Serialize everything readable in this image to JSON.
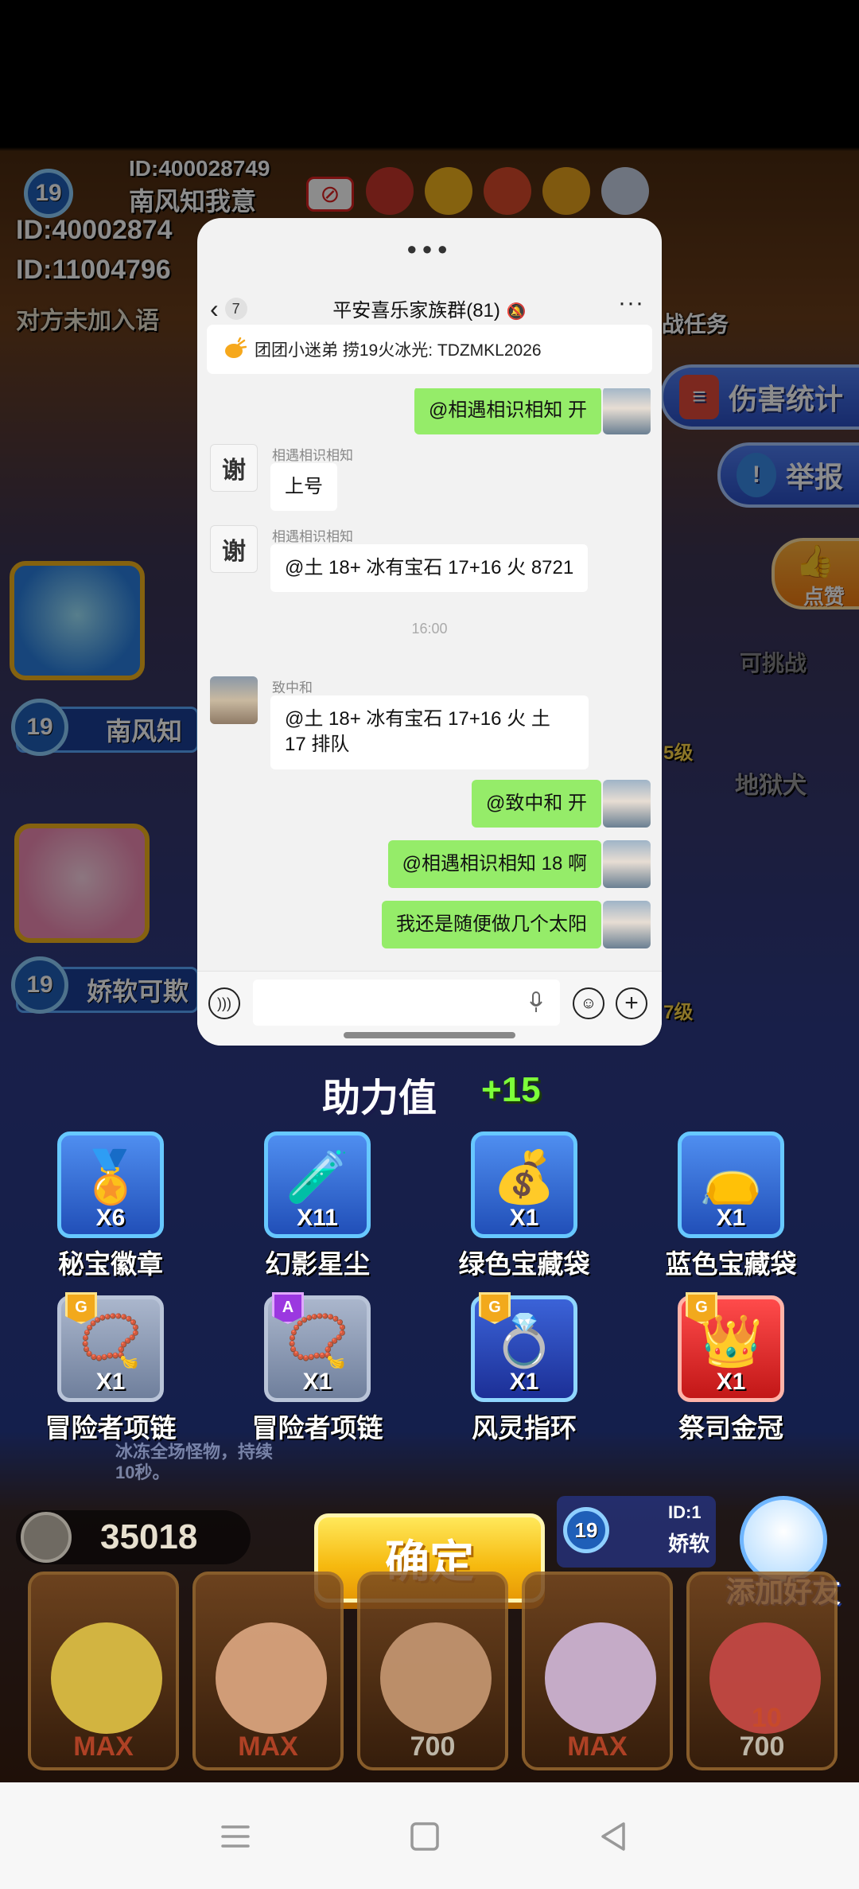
{
  "game": {
    "top_player": {
      "id": "ID:400028749",
      "level": "19",
      "name": "南风知我意"
    },
    "id_lines": [
      "ID:40002874",
      "ID:11004796"
    ],
    "voice_notice": "对方未加入语",
    "tasks_label": "战任务",
    "side_buttons": {
      "damage": "伤害统计",
      "report": "举报",
      "like": "点赞"
    },
    "slots": [
      {
        "level": "19",
        "name": "南风知"
      },
      {
        "level": "19",
        "name": "娇软可欺"
      }
    ],
    "right_labels": {
      "challenge": "可挑战",
      "hellhound": "地狱犬",
      "level_a": "5级",
      "level_b": "7级"
    },
    "assist": {
      "title": "助力值",
      "value": "+15"
    },
    "rewards": [
      {
        "name": "秘宝徽章",
        "qty": "X6",
        "icon": "exp-badge-icon",
        "style": "normal"
      },
      {
        "name": "幻影星尘",
        "qty": "X11",
        "icon": "stardust-bottle-icon",
        "style": "normal"
      },
      {
        "name": "绿色宝藏袋",
        "qty": "X1",
        "icon": "green-bag-icon",
        "style": "normal"
      },
      {
        "name": "蓝色宝藏袋",
        "qty": "X1",
        "icon": "blue-bag-icon",
        "style": "normal"
      },
      {
        "name": "冒险者项链",
        "qty": "X1",
        "icon": "necklace-icon",
        "style": "gray",
        "grade": "G"
      },
      {
        "name": "冒险者项链",
        "qty": "X1",
        "icon": "necklace-icon",
        "style": "gray",
        "grade": "A"
      },
      {
        "name": "风灵指环",
        "qty": "X1",
        "icon": "ring-icon",
        "style": "blue",
        "grade": "G"
      },
      {
        "name": "祭司金冠",
        "qty": "X1",
        "icon": "crown-icon",
        "style": "red",
        "grade": "G"
      }
    ],
    "bottom_tip": "冰冻全场怪物，持续10秒。",
    "coins": "35018",
    "confirm_label": "确定",
    "add_friend_label": "添加好友",
    "opponent_level": "19",
    "opponent_name": "娇软",
    "opponent_id": "ID:1",
    "hero_tags": [
      "MAX",
      "MAX",
      "700",
      "MAX",
      "700"
    ],
    "hero_counter": "10"
  },
  "chat": {
    "title": "平安喜乐家族群(81)",
    "unread_count": "7",
    "pinned": "团团小迷弟 捞19火冰光: TDZMKL2026",
    "messages": [
      {
        "side": "out",
        "text": "@相遇相识相知  开"
      },
      {
        "side": "in",
        "sender": "相遇相识相知",
        "text": "上号",
        "avatar": "谢"
      },
      {
        "side": "in",
        "sender": "相遇相识相知",
        "text": "@土 18+ 冰有宝石 17+16 火  8721",
        "avatar": "谢"
      },
      {
        "side": "time",
        "text": "16:00"
      },
      {
        "side": "in",
        "sender": "致中和",
        "text": "@土 18+ 冰有宝石 17+16 火   土 17 排队"
      },
      {
        "side": "out",
        "text": "@致中和  开"
      },
      {
        "side": "out",
        "text": "@相遇相识相知 18 啊"
      },
      {
        "side": "out",
        "text": "我还是随便做几个太阳"
      }
    ],
    "input_value": ""
  },
  "colors": {
    "chat_out_bubble": "#95ec69",
    "chat_bg": "#f2f2f2",
    "confirm_button": "#f6b90f"
  }
}
